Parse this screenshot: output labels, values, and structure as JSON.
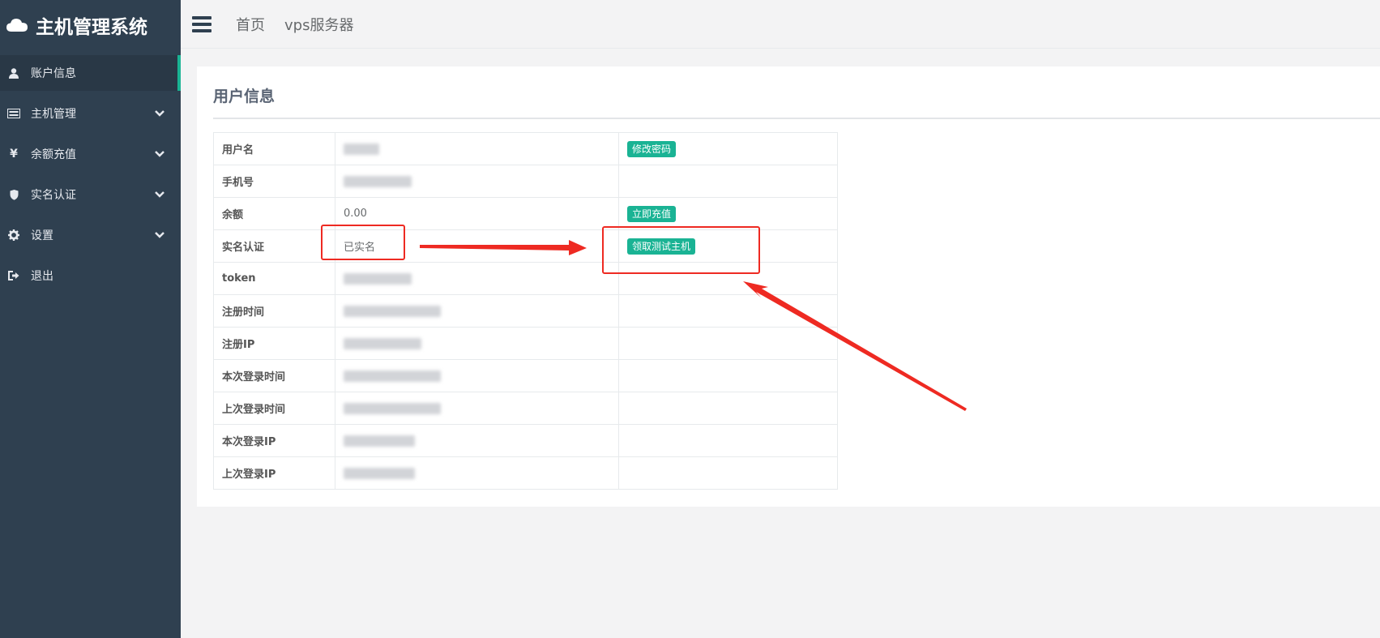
{
  "sidebar": {
    "brand": "主机管理系统",
    "items": [
      {
        "label": "账户信息",
        "icon": "user-icon"
      },
      {
        "label": "主机管理",
        "icon": "server-icon"
      },
      {
        "label": "余额充值",
        "icon": "yen-icon"
      },
      {
        "label": "实名认证",
        "icon": "shield-icon"
      },
      {
        "label": "设置",
        "icon": "gear-icon"
      },
      {
        "label": "退出",
        "icon": "sign-out-icon"
      }
    ]
  },
  "topbar": {
    "links": [
      "首页",
      "vps服务器"
    ]
  },
  "panel": {
    "title": "用户信息",
    "rows": [
      {
        "key": "用户名",
        "value": "",
        "action": "修改密码"
      },
      {
        "key": "手机号",
        "value": "",
        "action": ""
      },
      {
        "key": "余额",
        "value": "0.00",
        "action": "立即充值"
      },
      {
        "key": "实名认证",
        "value": "已实名",
        "action": "领取测试主机"
      },
      {
        "key": "token",
        "value": "",
        "action": ""
      },
      {
        "key": "注册时间",
        "value": "",
        "action": ""
      },
      {
        "key": "注册IP",
        "value": "",
        "action": ""
      },
      {
        "key": "本次登录时间",
        "value": "",
        "action": ""
      },
      {
        "key": "上次登录时间",
        "value": "",
        "action": ""
      },
      {
        "key": "本次登录IP",
        "value": "",
        "action": ""
      },
      {
        "key": "上次登录IP",
        "value": "",
        "action": ""
      }
    ]
  },
  "colors": {
    "sidebar_bg": "#2f4050",
    "accent": "#1ab394",
    "annotation": "#ee2a22"
  }
}
